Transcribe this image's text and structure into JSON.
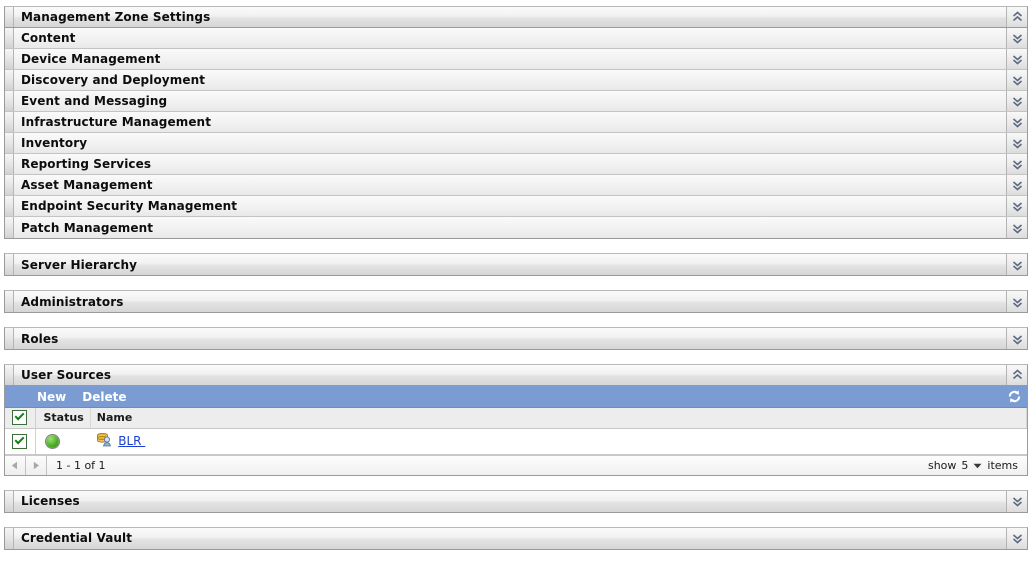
{
  "accordion": {
    "title": "Management Zone Settings",
    "toggle_icon": "chevrons-up-icon",
    "items": [
      {
        "label": "Content",
        "toggle_icon": "chevrons-down-icon"
      },
      {
        "label": "Device Management",
        "toggle_icon": "chevrons-down-icon"
      },
      {
        "label": "Discovery and Deployment",
        "toggle_icon": "chevrons-down-icon"
      },
      {
        "label": "Event and Messaging",
        "toggle_icon": "chevrons-down-icon"
      },
      {
        "label": "Infrastructure Management",
        "toggle_icon": "chevrons-down-icon"
      },
      {
        "label": "Inventory",
        "toggle_icon": "chevrons-down-icon"
      },
      {
        "label": "Reporting Services",
        "toggle_icon": "chevrons-down-icon"
      },
      {
        "label": "Asset Management",
        "toggle_icon": "chevrons-down-icon"
      },
      {
        "label": "Endpoint Security Management",
        "toggle_icon": "chevrons-down-icon"
      },
      {
        "label": "Patch Management",
        "toggle_icon": "chevrons-down-icon"
      }
    ]
  },
  "panels": {
    "server_hierarchy": {
      "title": "Server Hierarchy",
      "toggle_icon": "chevrons-down-icon"
    },
    "administrators": {
      "title": "Administrators",
      "toggle_icon": "chevrons-down-icon"
    },
    "roles": {
      "title": "Roles",
      "toggle_icon": "chevrons-down-icon"
    },
    "licenses": {
      "title": "Licenses",
      "toggle_icon": "chevrons-down-icon"
    },
    "credential_vault": {
      "title": "Credential Vault",
      "toggle_icon": "chevrons-down-icon"
    }
  },
  "user_sources": {
    "title": "User Sources",
    "toggle_icon": "chevrons-up-icon",
    "toolbar": {
      "new_label": "New",
      "delete_label": "Delete",
      "refresh_icon": "refresh-icon"
    },
    "columns": {
      "select_all": "select-all-checkbox",
      "status": "Status",
      "name": "Name"
    },
    "rows": [
      {
        "selected": true,
        "status_icon": "status-green-icon",
        "source_icon": "user-source-icon",
        "name": "BLR "
      }
    ],
    "pager": {
      "prev_icon": "triangle-left-icon",
      "next_icon": "triangle-right-icon",
      "range_label": "1 - 1 of 1",
      "show_label": "show",
      "page_size": "5",
      "items_label": "items",
      "caret_icon": "caret-down-icon"
    }
  },
  "colors": {
    "toolbar_blue": "#7a9cd2",
    "link_blue": "#1b3fd0",
    "status_green": "#49b021",
    "panel_border": "#9a9a9a"
  }
}
